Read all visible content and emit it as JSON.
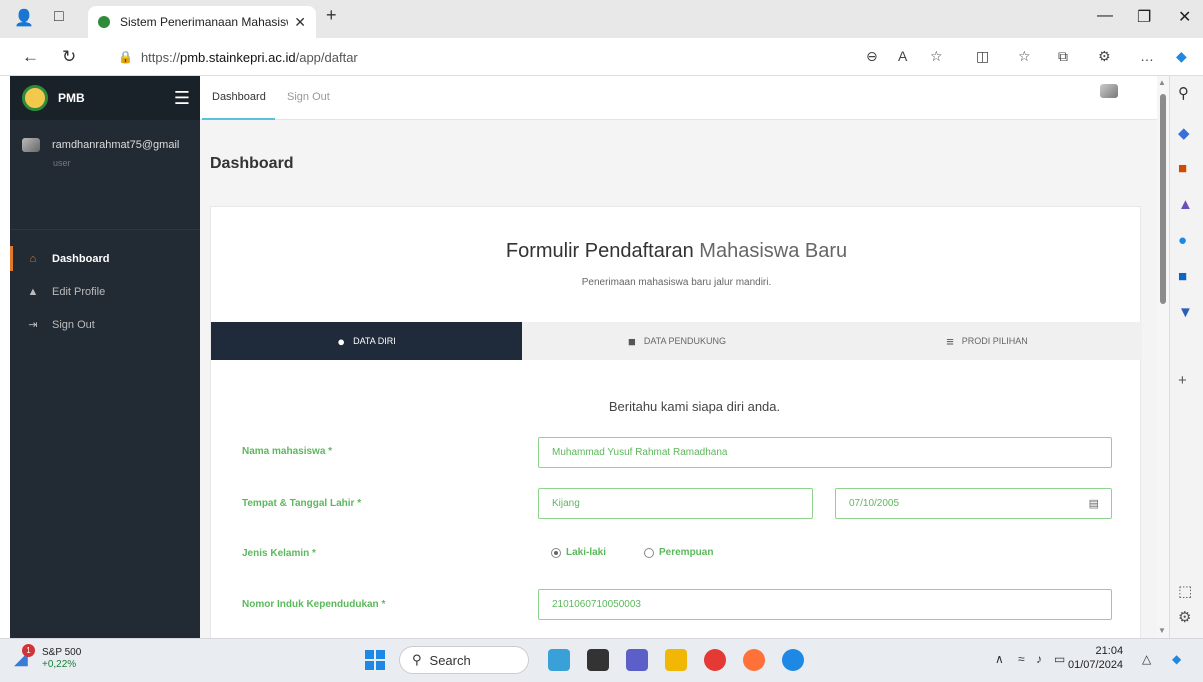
{
  "browser": {
    "tab_title": "Sistem Penerimanaan Mahasiswa",
    "url_prefix": "https://",
    "url_domain": "pmb.stainkepri.ac.id",
    "url_path": "/app/daftar"
  },
  "sidebar": {
    "brand": "PMB",
    "user_email": "ramdhanrahmat75@gmail",
    "user_role": "user",
    "items": [
      {
        "label": "Dashboard",
        "icon": "home-icon"
      },
      {
        "label": "Edit Profile",
        "icon": "user-icon"
      },
      {
        "label": "Sign Out",
        "icon": "sign-out-icon"
      }
    ]
  },
  "topnav": {
    "dashboard": "Dashboard",
    "signout": "Sign Out"
  },
  "page": {
    "title": "Dashboard"
  },
  "form": {
    "title_bold": "Formulir Pendaftaran",
    "title_thin": "Mahasiswa Baru",
    "subtitle": "Penerimaan mahasiswa baru jalur mandiri.",
    "steps": [
      {
        "label": "DATA DIRI",
        "icon": "user-icon"
      },
      {
        "label": "DATA PENDUKUNG",
        "icon": "file-icon"
      },
      {
        "label": "PRODI PILIHAN",
        "icon": "signpost-icon"
      }
    ],
    "intro": "Beritahu kami siapa diri anda.",
    "fields": {
      "nama_label": "Nama mahasiswa *",
      "nama_value": "Muhammad Yusuf Rahmat Ramadhana",
      "ttl_label": "Tempat & Tanggal Lahir *",
      "tempat_value": "Kijang",
      "tanggal_value": "07/10/2005",
      "jk_label": "Jenis Kelamin *",
      "jk_opt1": "Laki-laki",
      "jk_opt2": "Perempuan",
      "nik_label": "Nomor Induk Kependudukan *",
      "nik_value": "2101060710050003"
    }
  },
  "taskbar": {
    "stock_name": "S&P 500",
    "stock_change": "+0,22%",
    "stock_badge": "1",
    "search_label": "Search",
    "time": "21:04",
    "date": "01/07/2024"
  },
  "colors": {
    "sidebar_bg": "#222b34",
    "wizard_active": "#1f2a3a",
    "field_green": "#5cb85c",
    "accent_orange": "#e07a2a"
  }
}
